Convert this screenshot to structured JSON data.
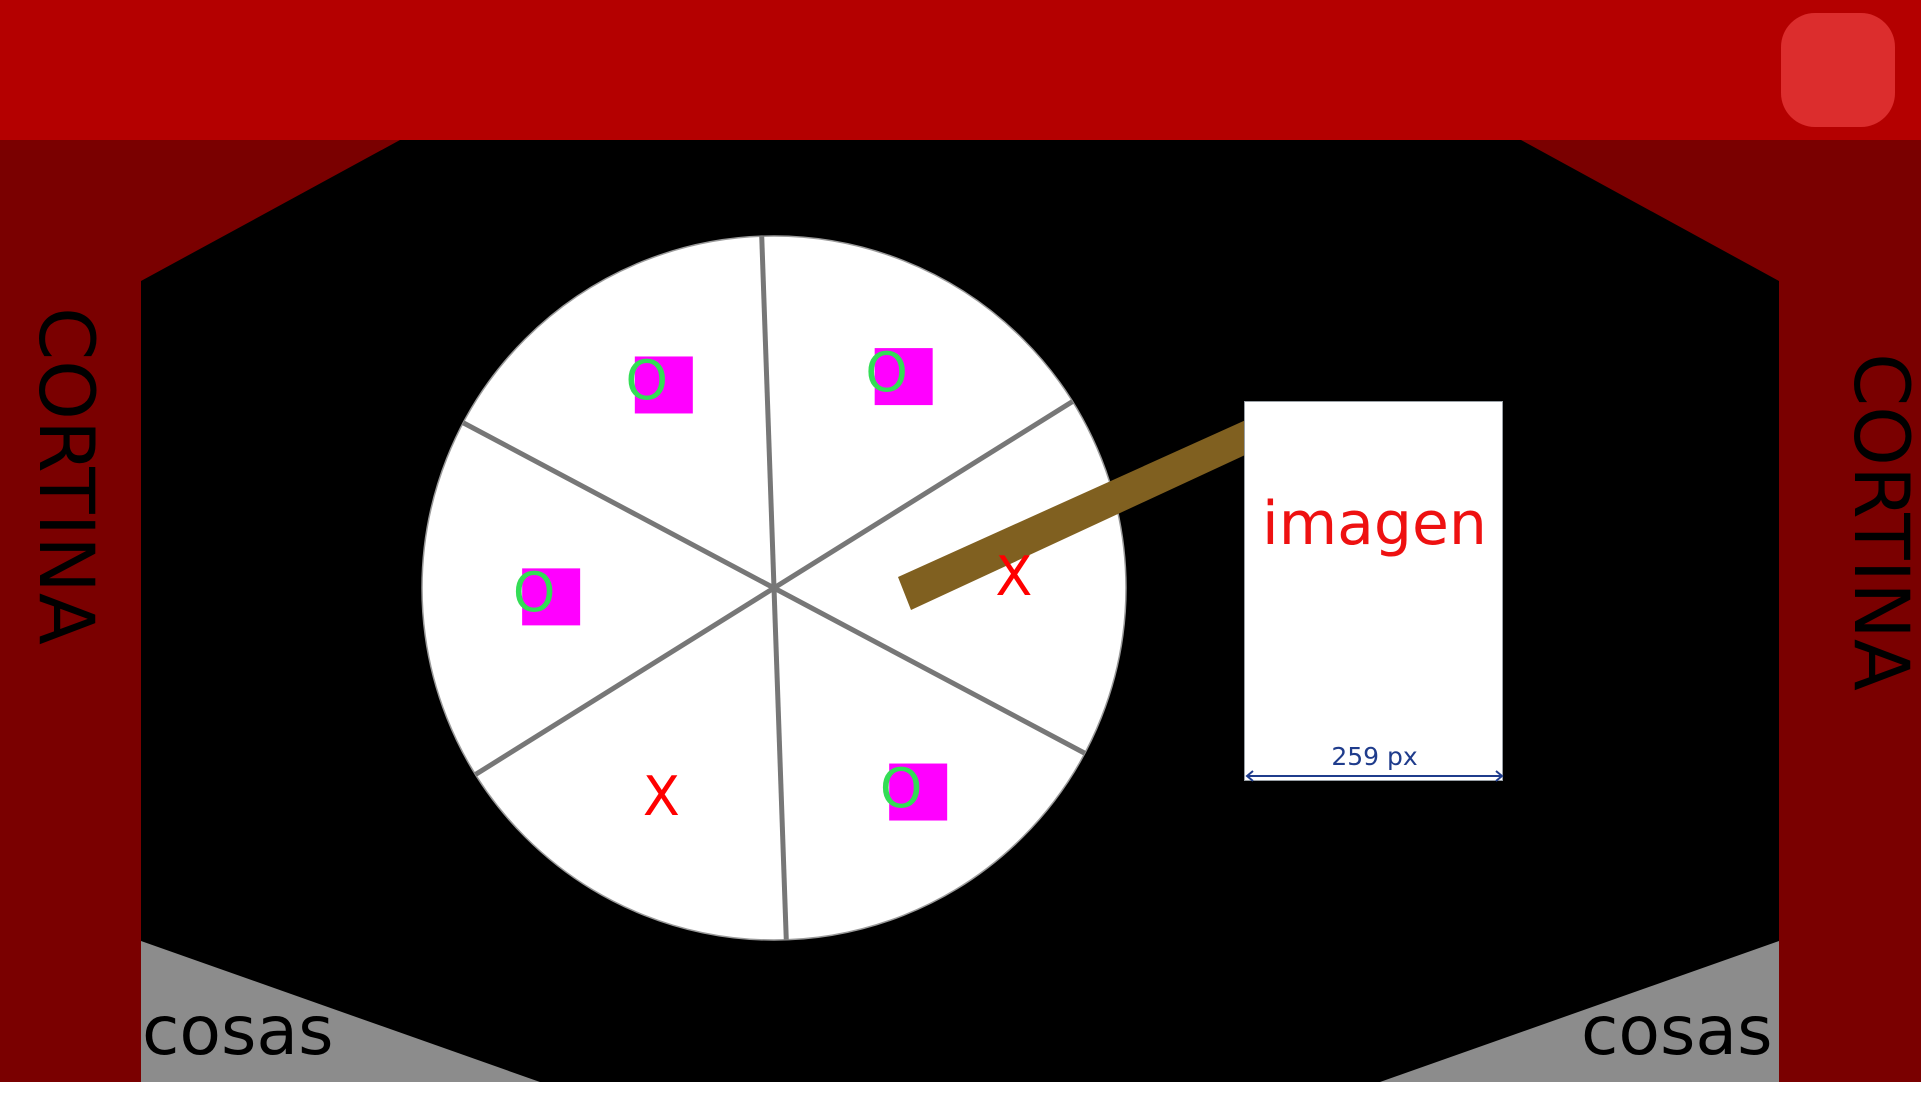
{
  "header": {
    "corner_button": ""
  },
  "stage": {
    "curtain_left": "CORTINA",
    "curtain_right": "CORTINA",
    "corner_left": "cosas",
    "corner_right": "cosas"
  },
  "wheel": {
    "sectors": [
      {
        "mark": "X",
        "square": false
      },
      {
        "mark": "O",
        "square": true
      },
      {
        "mark": "O",
        "square": true
      },
      {
        "mark": "O",
        "square": true
      },
      {
        "mark": "X",
        "square": false
      },
      {
        "mark": "O",
        "square": true
      }
    ]
  },
  "image_card": {
    "text": "imagen",
    "width_label": "259 px"
  },
  "colors": {
    "top_bar": "#b40000",
    "corner_button": "#dc2d2d",
    "curtain": "#7a0000",
    "stage": "#000000",
    "floor": "#8c8c8c",
    "x_mark": "#ff0000",
    "o_mark": "#33dd55",
    "square": "#ff00ff",
    "pointer": "#806020"
  }
}
